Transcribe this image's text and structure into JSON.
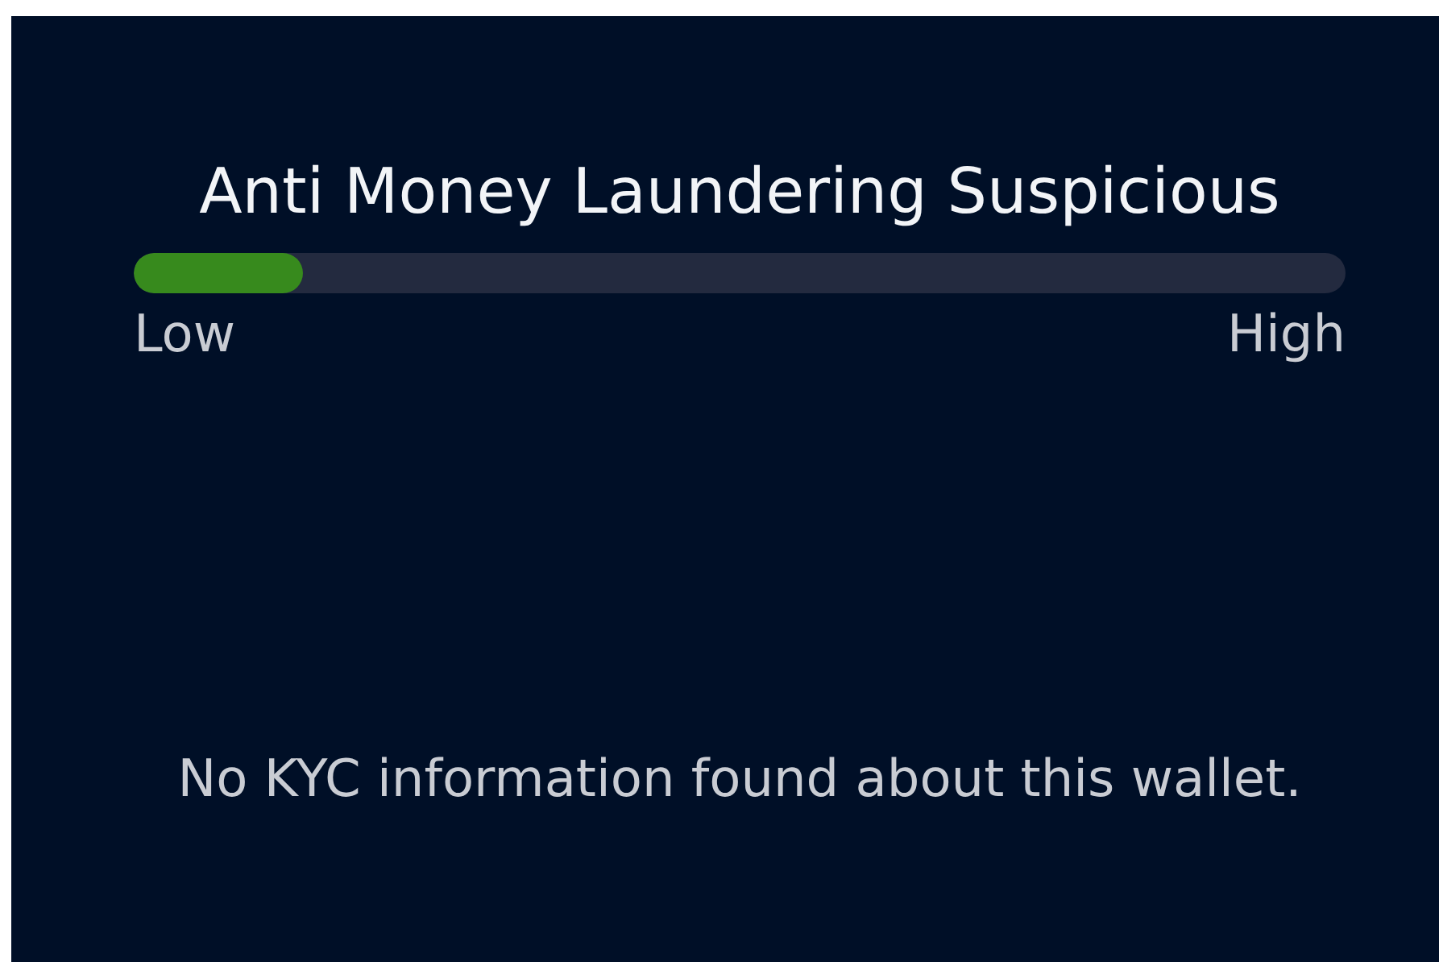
{
  "title": "Anti Money Laundering Suspicious",
  "meter": {
    "level": 0.14,
    "min_label": "Low",
    "max_label": "High"
  },
  "message": "No KYC information found about this wallet."
}
